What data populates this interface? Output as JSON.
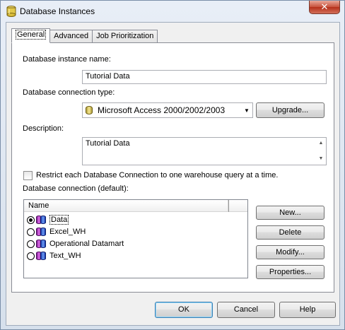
{
  "window": {
    "title": "Database Instances",
    "close_label": "✕"
  },
  "tabs": [
    {
      "label": "General",
      "active": true
    },
    {
      "label": "Advanced",
      "active": false
    },
    {
      "label": "Job Prioritization",
      "active": false
    }
  ],
  "general": {
    "instance_name_label": "Database instance name:",
    "instance_name_value": "Tutorial Data",
    "connection_type_label": "Database connection type:",
    "connection_type_value": "Microsoft Access 2000/2002/2003",
    "upgrade_label": "Upgrade...",
    "description_label": "Description:",
    "description_value": "Tutorial Data",
    "restrict_label": "Restrict each Database Connection to one warehouse query at a time.",
    "restrict_checked": false,
    "connection_default_label": "Database connection (default):",
    "list_header": "Name",
    "connections": [
      {
        "name": "Data",
        "selected": true
      },
      {
        "name": "Excel_WH",
        "selected": false
      },
      {
        "name": "Operational Datamart",
        "selected": false
      },
      {
        "name": "Text_WH",
        "selected": false
      }
    ],
    "buttons": {
      "new": "New...",
      "delete": "Delete",
      "modify": "Modify...",
      "properties": "Properties..."
    }
  },
  "footer": {
    "ok": "OK",
    "cancel": "Cancel",
    "help": "Help"
  },
  "colors": {
    "accent": "#3c7fb1",
    "close": "#c7503a"
  }
}
